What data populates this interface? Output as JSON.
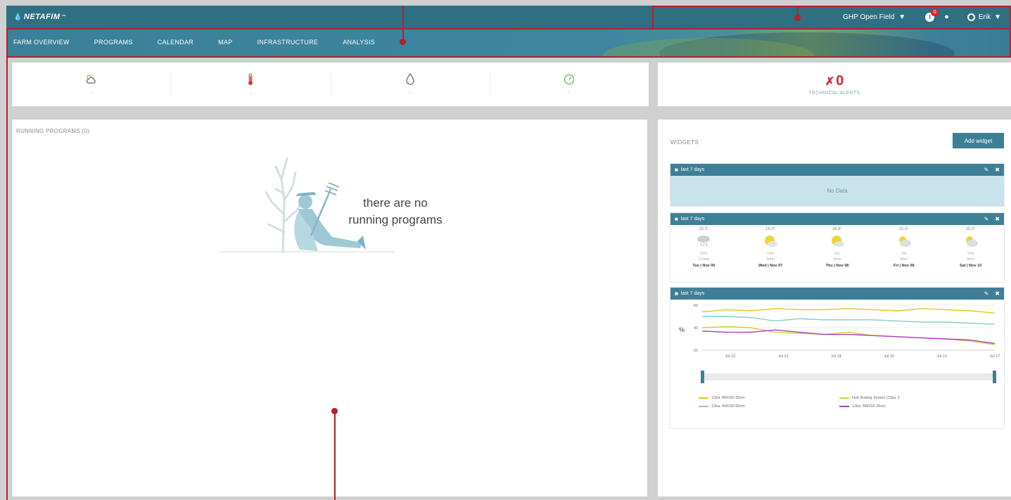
{
  "brand": {
    "logo_text": "NETAFIM",
    "logo_mark": "™"
  },
  "header": {
    "farm_select": "GHP Open Field",
    "alert_count": "0",
    "user_name": "Erik"
  },
  "nav": {
    "items": [
      "FARM OVERVIEW",
      "PROGRAMS",
      "CALENDAR",
      "MAP",
      "INFRASTRUCTURE",
      "ANALYSIS"
    ]
  },
  "stats": [
    {
      "icon": "weather-icon",
      "value": "-"
    },
    {
      "icon": "thermometer-icon",
      "value": "-"
    },
    {
      "icon": "water-drop-icon",
      "value": "-"
    },
    {
      "icon": "gauge-icon",
      "value": "-"
    }
  ],
  "technical_alerts": {
    "count": "0",
    "label": "TECHNICAL ALERTS"
  },
  "running_programs": {
    "title": "RUNNING PROGRAMS (0)",
    "empty_line1": "there are no",
    "empty_line2": "running programs"
  },
  "widgets": {
    "title": "WIDGETS",
    "add_button": "Add widget",
    "widget1": {
      "title": "last 7 days",
      "no_data": "No Data"
    },
    "widget2": {
      "title": "last 7 days",
      "days": [
        {
          "temp": "15.0°",
          "rain_pct": "35%",
          "rain_mm": "0.5mm",
          "date": "Tue | Nov 06",
          "icon": "rain-cloud-icon"
        },
        {
          "temp": "16.0°",
          "rain_pct": "10%",
          "rain_mm": "0mm",
          "date": "Wed | Nov 07",
          "icon": "sun-cloud-icon"
        },
        {
          "temp": "16.8°",
          "rain_pct": "0%",
          "rain_mm": "0mm",
          "date": "Thu | Nov 08",
          "icon": "sun-cloud-icon"
        },
        {
          "temp": "15.0°",
          "rain_pct": "0%",
          "rain_mm": "0mm",
          "date": "Fri | Nov 09",
          "icon": "partly-cloudy-icon"
        },
        {
          "temp": "15.0°",
          "rain_pct": "10%",
          "rain_mm": "0mm",
          "date": "Sat | Nov 10",
          "icon": "partly-cloudy-icon"
        }
      ]
    },
    "widget3": {
      "title": "last 7 days",
      "chart_data": {
        "type": "line",
        "x": [
          "Jul 12",
          "Jul 13",
          "Jul 14",
          "Jul 15",
          "Jul 16",
          "Jul 17"
        ],
        "ylim": [
          20,
          60
        ],
        "yticks": [
          "60",
          "40",
          "20"
        ],
        "ylabel": "%",
        "series": [
          {
            "name": "12ba: BM150 25cm",
            "color": "#e8c21c",
            "values": [
              54,
              56,
              55,
              57,
              56,
              56,
              57,
              56,
              55,
              57,
              56,
              55,
              53
            ]
          },
          {
            "name": "Hub Analog Sensor (1)ba: 1",
            "color": "#c6d23a",
            "values": [
              40,
              41,
              40,
              36,
              35,
              34,
              36,
              33,
              32,
              31,
              30,
              28,
              25
            ]
          },
          {
            "name": "12ba: BM150 50cm",
            "color": "#7fcfc9",
            "values": [
              50,
              50,
              49,
              46,
              48,
              47,
              47,
              47,
              46,
              45,
              45,
              44,
              43
            ]
          },
          {
            "name": "12ba: BM150 25cm",
            "color": "#b13bc0",
            "values": [
              37,
              36,
              36,
              38,
              36,
              34,
              34,
              33,
              32,
              31,
              30,
              29,
              26
            ]
          }
        ]
      }
    }
  }
}
